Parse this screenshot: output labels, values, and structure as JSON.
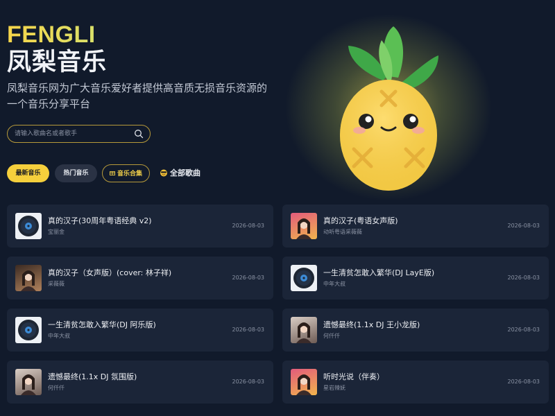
{
  "hero": {
    "brand_en": "FENGLI",
    "brand_cn": "凤梨音乐",
    "slogan": "凤梨音乐网为广大音乐爱好者提供高音质无损音乐资源的一个音乐分享平台"
  },
  "search": {
    "placeholder": "请输入歌曲名或者歌手",
    "icon": "search-icon"
  },
  "tabs": {
    "latest": "最新音乐",
    "hot": "热门音乐",
    "collection": "音乐合集",
    "all": "全部歌曲"
  },
  "colors": {
    "background": "#111a2b",
    "card": "#1b2538",
    "accent": "#f5cf3c",
    "brand_gradient_start": "#f6d54a",
    "brand_gradient_end": "#d9e06a"
  },
  "songs": [
    {
      "title": "真的汉子(30周年粤语经典 v2)",
      "artist": "宝丽金",
      "date": "2026-08-03",
      "cover": "disc"
    },
    {
      "title": "真的汉子(粤语女声版)",
      "artist": "动听粤语采薇薇",
      "date": "2026-08-03",
      "cover": "photo-pink"
    },
    {
      "title": "真的汉子（女声版）(cover: 林子祥)",
      "artist": "采薇薇",
      "date": "2026-08-03",
      "cover": "photo-dark"
    },
    {
      "title": "一生清贫怎敢入繁华(DJ LayE版)",
      "artist": "中年大叔",
      "date": "2026-08-03",
      "cover": "disc"
    },
    {
      "title": "一生清贫怎敢入繁华(DJ 阿乐版)",
      "artist": "中年大叔",
      "date": "2026-08-03",
      "cover": "disc"
    },
    {
      "title": "遗憾最终(1.1x DJ 王小龙版)",
      "artist": "何仟仟",
      "date": "2026-08-03",
      "cover": "photo-light"
    },
    {
      "title": "遗憾最终(1.1x DJ 氛围版)",
      "artist": "何仟仟",
      "date": "2026-08-03",
      "cover": "photo-light"
    },
    {
      "title": "听时光说（伴奏）",
      "artist": "星岩辣妩",
      "date": "2026-08-03",
      "cover": "photo-pink"
    }
  ]
}
